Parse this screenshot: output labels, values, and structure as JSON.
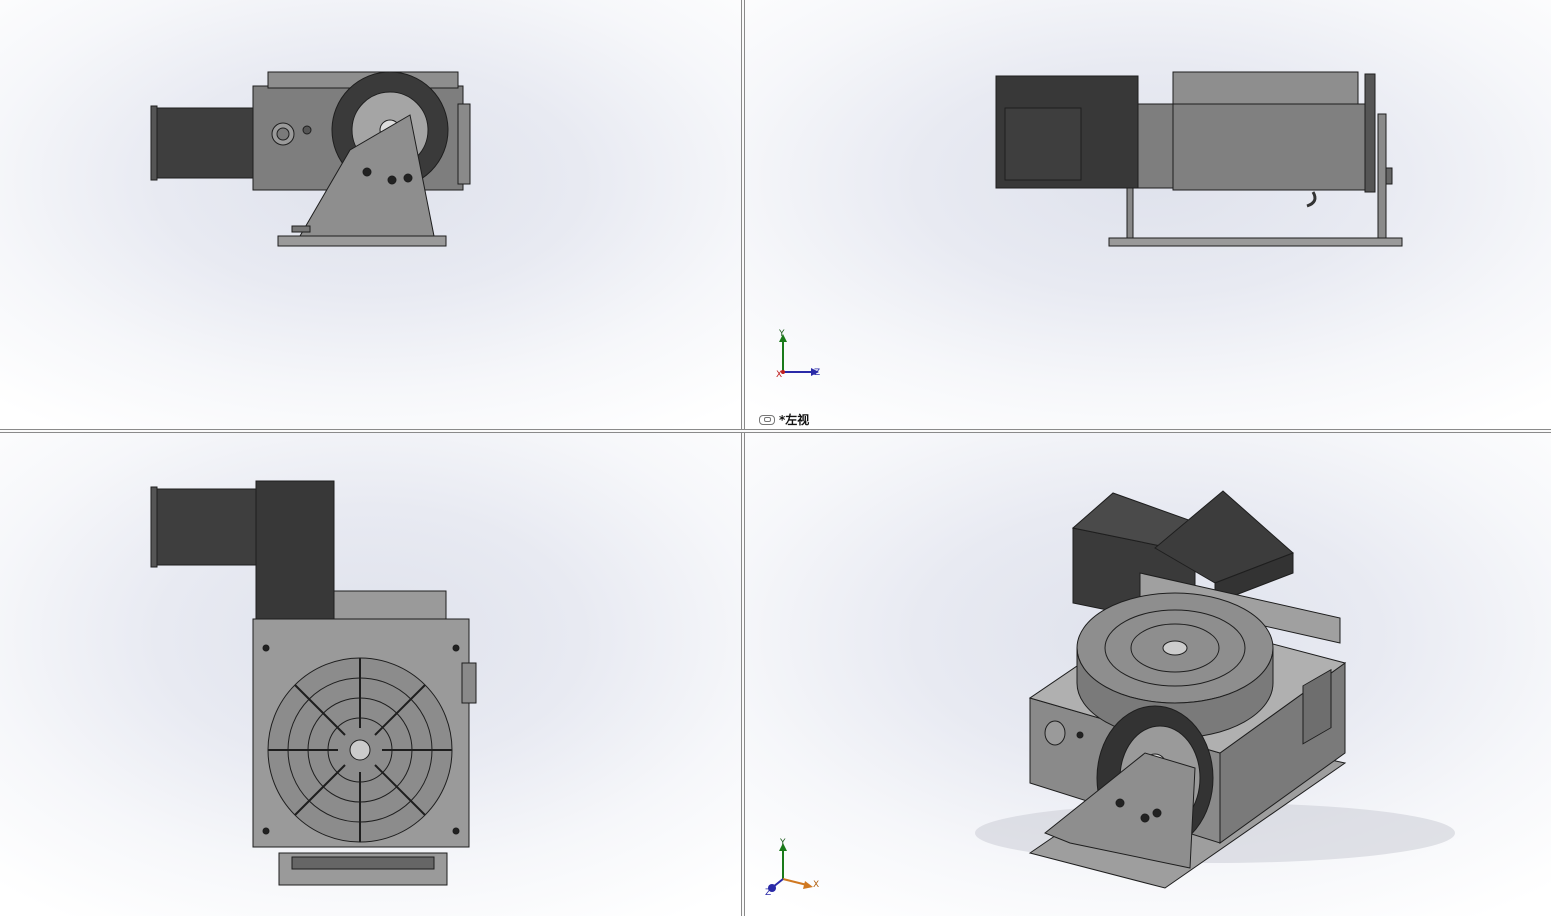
{
  "views": {
    "top_left": {
      "label": ""
    },
    "top_right": {
      "label": "*左视",
      "icon": "link-icon"
    },
    "bottom_left": {
      "label": ""
    },
    "bottom_right": {
      "label": ""
    }
  },
  "triad_left": {
    "y": "Y",
    "z": "Z",
    "x": "X"
  },
  "triad_iso": {
    "y": "Y",
    "z": "Z",
    "x": "X"
  },
  "colors": {
    "steel": "#808080",
    "dark": "#3a3a3a",
    "edge": "#1e1e1e",
    "light": "#a9a9a9"
  }
}
